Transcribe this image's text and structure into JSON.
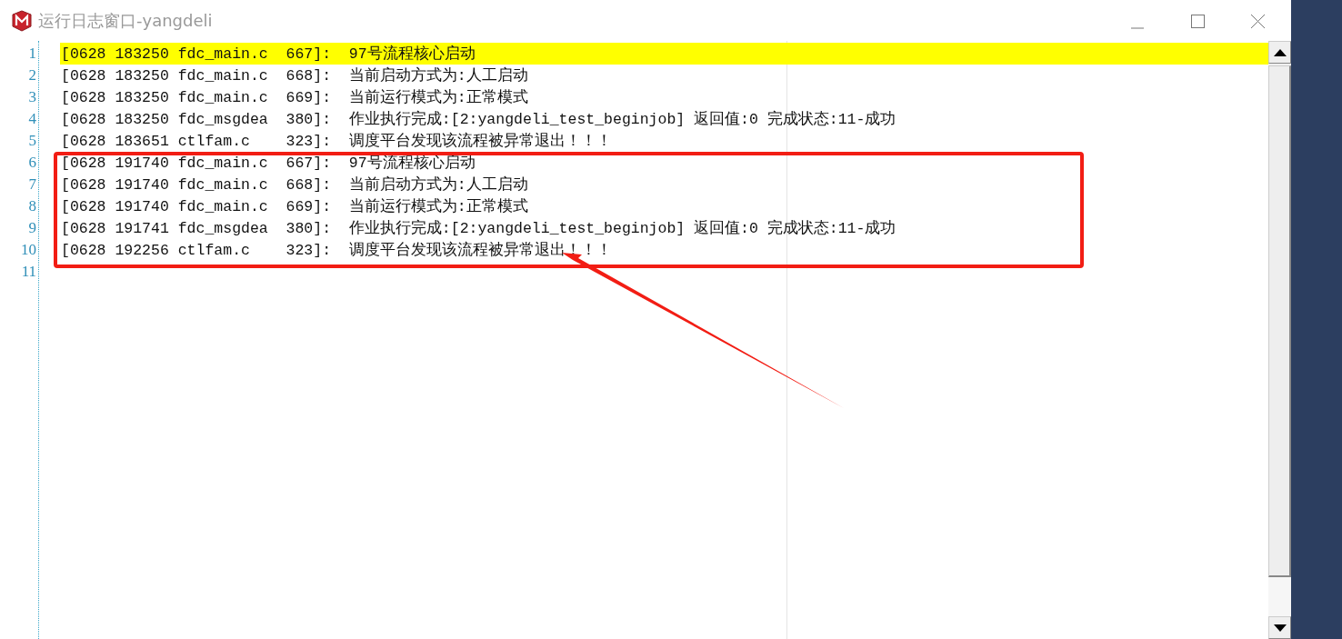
{
  "window": {
    "title": "运行日志窗口-yangdeli"
  },
  "lines": [
    {
      "number": "1",
      "text": "[0628 183250 fdc_main.c  667]:  97号流程核心启动",
      "highlighted": true
    },
    {
      "number": "2",
      "text": "[0628 183250 fdc_main.c  668]:  当前启动方式为:人工启动",
      "highlighted": false
    },
    {
      "number": "3",
      "text": "[0628 183250 fdc_main.c  669]:  当前运行模式为:正常模式",
      "highlighted": false
    },
    {
      "number": "4",
      "text": "[0628 183250 fdc_msgdea  380]:  作业执行完成:[2:yangdeli_test_beginjob] 返回值:0 完成状态:11-成功",
      "highlighted": false
    },
    {
      "number": "5",
      "text": "[0628 183651 ctlfam.c    323]:  调度平台发现该流程被异常退出！！！",
      "highlighted": false
    },
    {
      "number": "6",
      "text": "[0628 191740 fdc_main.c  667]:  97号流程核心启动",
      "highlighted": false
    },
    {
      "number": "7",
      "text": "[0628 191740 fdc_main.c  668]:  当前启动方式为:人工启动",
      "highlighted": false
    },
    {
      "number": "8",
      "text": "[0628 191740 fdc_main.c  669]:  当前运行模式为:正常模式",
      "highlighted": false
    },
    {
      "number": "9",
      "text": "[0628 191741 fdc_msgdea  380]:  作业执行完成:[2:yangdeli_test_beginjob] 返回值:0 完成状态:11-成功",
      "highlighted": false
    },
    {
      "number": "10",
      "text": "[0628 192256 ctlfam.c    323]:  调度平台发现该流程被异常退出！！！",
      "highlighted": false
    },
    {
      "number": "11",
      "highlighted": false
    }
  ]
}
